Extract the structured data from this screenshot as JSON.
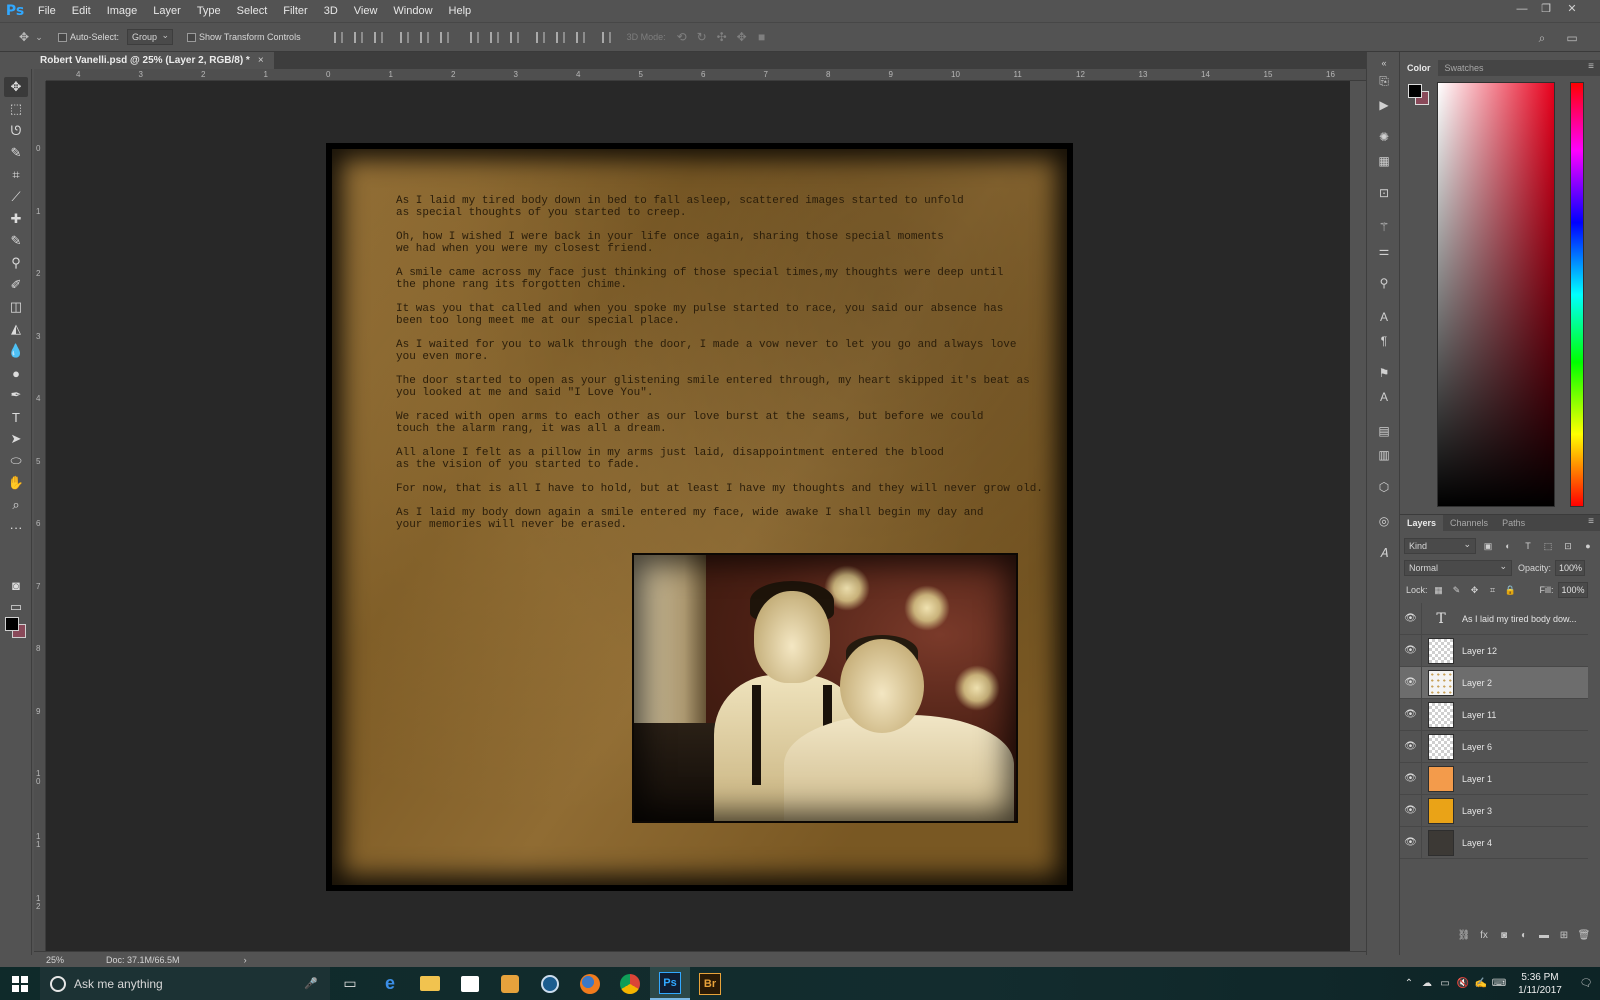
{
  "app": {
    "logo": "Ps",
    "menu": [
      "File",
      "Edit",
      "Image",
      "Layer",
      "Type",
      "Select",
      "Filter",
      "3D",
      "View",
      "Window",
      "Help"
    ]
  },
  "options_bar": {
    "auto_select_label": "Auto-Select:",
    "auto_select_value": "Group",
    "transform_controls_label": "Show Transform Controls",
    "mode_3d_label": "3D Mode:"
  },
  "document": {
    "tab_title": "Robert Vanelli.psd @ 25% (Layer 2, RGB/8) *",
    "zoom": "25%",
    "doc_size": "Doc: 37.1M/66.5M"
  },
  "ruler": {
    "h_ticks": [
      "4",
      "3",
      "2",
      "1",
      "0",
      "1",
      "2",
      "3",
      "4",
      "5",
      "6",
      "7",
      "8",
      "9",
      "10",
      "11",
      "12",
      "13",
      "14",
      "15",
      "16"
    ],
    "v_ticks": [
      "0",
      "1",
      "2",
      "3",
      "4",
      "5",
      "6",
      "7",
      "8",
      "9",
      "1\n0",
      "1\n1",
      "1\n2"
    ]
  },
  "poem": [
    "As I laid my tired body down in bed to fall asleep, scattered images started to unfold\nas special thoughts of you started to creep.",
    "Oh, how I wished I were back in your life once again, sharing those special moments\nwe had when you were my closest friend.",
    "A smile came across my face just thinking of those special times,my thoughts were deep until\nthe phone rang its forgotten chime.",
    "It was you that called and when you spoke my pulse started to race, you said our absence has\nbeen too long meet me at our special place.",
    "As I waited for you to walk through the door, I made a vow never to let you go and always love\nyou even more.",
    "The door started to open as your glistening smile entered through, my heart skipped it's beat as\nyou looked at me and said \"I Love You\".",
    "We raced with open arms to each other as our love burst at the seams, but before we could\ntouch the alarm rang, it was all a dream.",
    "All alone I felt as a pillow in my arms just laid, disappointment entered the blood\nas the vision of you started to fade.",
    "For now, that is all I have to hold, but at least I have my thoughts and they will never grow old.",
    "As I laid my body down again a smile entered my face, wide awake I shall begin my day and\nyour memories will never be erased."
  ],
  "color_panel": {
    "tabs": [
      "Color",
      "Swatches"
    ],
    "foreground": "#000000",
    "background": "#8a4a5a"
  },
  "layers_panel": {
    "tabs": [
      "Layers",
      "Channels",
      "Paths"
    ],
    "kind_label": "Kind",
    "blend_mode": "Normal",
    "opacity_label": "Opacity:",
    "opacity_value": "100%",
    "lock_label": "Lock:",
    "fill_label": "Fill:",
    "fill_value": "100%",
    "layers": [
      {
        "name": "As I laid my tired body dow...",
        "type": "text",
        "selected": false
      },
      {
        "name": "Layer 12",
        "type": "transparent",
        "selected": false
      },
      {
        "name": "Layer 2",
        "type": "photo",
        "selected": true
      },
      {
        "name": "Layer 11",
        "type": "transparent",
        "selected": false
      },
      {
        "name": "Layer 6",
        "type": "transparent",
        "selected": false
      },
      {
        "name": "Layer 1",
        "type": "fill",
        "color": "#f39b4b",
        "selected": false
      },
      {
        "name": "Layer 3",
        "type": "fill",
        "color": "#eaa317",
        "selected": false
      },
      {
        "name": "Layer 4",
        "type": "fill",
        "color": "#3c3935",
        "selected": false
      }
    ]
  },
  "taskbar": {
    "search_placeholder": "Ask me anything",
    "time": "5:36 PM",
    "date": "1/11/2017",
    "apps": [
      "task-view",
      "edge",
      "file-explorer",
      "store",
      "media-player",
      "steam",
      "firefox",
      "chrome",
      "photoshop",
      "bridge"
    ]
  }
}
